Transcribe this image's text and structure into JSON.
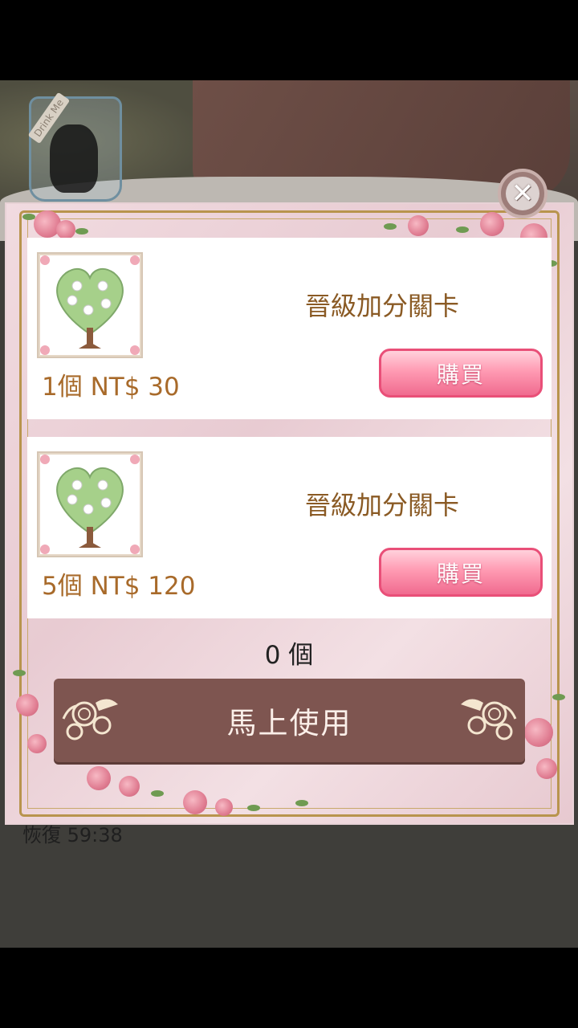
{
  "background": {
    "jar_label": "Drink Me",
    "recover_text": "恢復 59:38"
  },
  "dialog": {
    "close_icon": "close-icon",
    "products": [
      {
        "title": "晉級加分關卡",
        "price": "1個 NT$ 30",
        "buy_label": "購買",
        "image": "heart-tree-icon"
      },
      {
        "title": "晉級加分關卡",
        "price": "5個 NT$ 120",
        "buy_label": "購買",
        "image": "heart-tree-icon"
      }
    ],
    "count_text": "0 個",
    "use_now_label": "馬上使用"
  },
  "colors": {
    "buy_button": "#f06b8f",
    "use_now_button": "#7e5550",
    "price_text": "#a86a2a",
    "title_text": "#8a5a24"
  }
}
